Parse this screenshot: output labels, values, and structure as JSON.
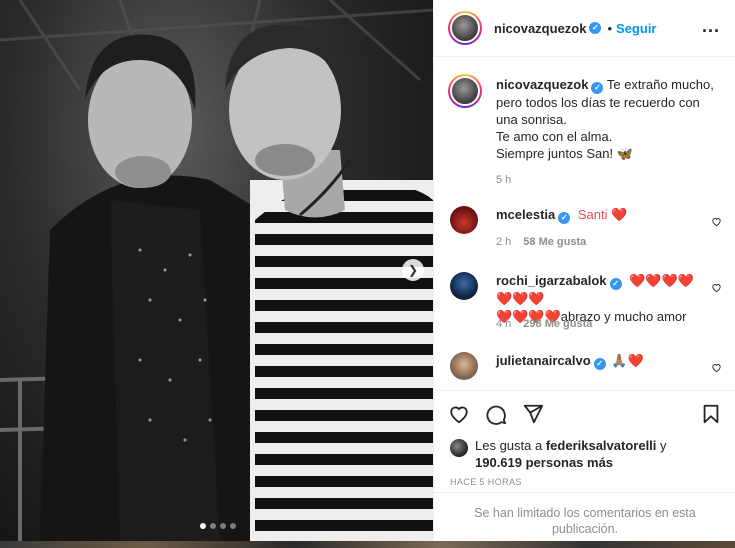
{
  "post": {
    "author": "nicovazquezok",
    "follow_label": "Seguir",
    "separator": "•",
    "more_label": "...",
    "caption_lines": [
      "Te extraño mucho,",
      "pero todos los días te recuerdo con",
      "una sonrisa.",
      "Te amo con el alma.",
      "Siempre juntos San! 🦋"
    ],
    "caption_time": "5 h"
  },
  "comments": [
    {
      "user": "mcelestia",
      "text": "Santi ❤️",
      "time": "2 h",
      "likes": "58 Me gusta"
    },
    {
      "user": "rochi_igarzabalok",
      "text_line1": "❤️❤️❤️❤️❤️❤️❤️",
      "text_line2": "❤️❤️❤️❤️abrazo y mucho amor",
      "time": "4 h",
      "likes": "298 Me gusta"
    },
    {
      "user": "julietanaircalvo",
      "text": "🙏🏽❤️"
    }
  ],
  "likes": {
    "prefix": "Les gusta a",
    "user": "federiksalvatorelli",
    "connector": "y",
    "count": "190.619 personas más"
  },
  "posted_ago": "HACE 5 HORAS",
  "comments_limited": "Se han limitado los comentarios en esta publicación.",
  "carousel": {
    "total": 4,
    "current": 1
  },
  "colors": {
    "verified": "#3897f0",
    "follow": "#0095f6",
    "like_red": "#ed4956"
  },
  "icons": [
    "verified-icon",
    "more-icon",
    "heart-icon",
    "comment-icon",
    "share-icon",
    "save-icon",
    "chevron-right-icon"
  ]
}
